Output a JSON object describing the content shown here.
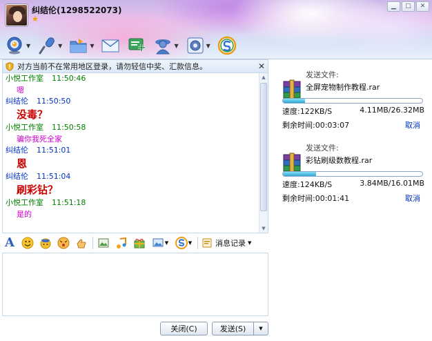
{
  "header": {
    "contact_name": "纠结伦(1298522073)",
    "window_buttons": [
      "minimize-icon",
      "maximize-icon",
      "close-icon"
    ],
    "toolbar": [
      {
        "name": "video-call",
        "icon": "webcam-icon",
        "has_dropdown": true
      },
      {
        "name": "voice-call",
        "icon": "microphone-icon",
        "has_dropdown": true
      },
      {
        "name": "send-file",
        "icon": "folder-icon",
        "has_dropdown": true
      },
      {
        "name": "send-mail",
        "icon": "envelope-icon",
        "has_dropdown": false
      },
      {
        "name": "create-discussion",
        "icon": "add-group-icon",
        "has_dropdown": false
      },
      {
        "name": "apps",
        "icon": "person-app-icon",
        "has_dropdown": true
      },
      {
        "name": "settings",
        "icon": "gear-icon",
        "has_dropdown": true
      },
      {
        "name": "soso",
        "icon": "soso-s-icon",
        "has_dropdown": false
      }
    ]
  },
  "notice": {
    "text": "对方当前不在常用地区登录，请勿轻信中奖、汇款信息。"
  },
  "chat": {
    "messages": [
      {
        "sender": "小悦工作室",
        "time": "11:50:46",
        "text": "嗯",
        "who": "other",
        "style": "normal"
      },
      {
        "sender": "纠结伦",
        "time": "11:50:50",
        "text": "没毒？",
        "who": "self",
        "style": "big"
      },
      {
        "sender": "小悦工作室",
        "time": "11:50:58",
        "text": "骗你我死全家",
        "who": "other",
        "style": "normal"
      },
      {
        "sender": "纠结伦",
        "time": "11:51:01",
        "text": "恩",
        "who": "self",
        "style": "big"
      },
      {
        "sender": "纠结伦",
        "time": "11:51:04",
        "text": "刷彩钻？",
        "who": "self",
        "style": "big"
      },
      {
        "sender": "小悦工作室",
        "time": "11:51:18",
        "text": "是的",
        "who": "other",
        "style": "normal"
      }
    ]
  },
  "format_toolbar": {
    "history_label": "消息记录"
  },
  "buttons": {
    "close_label": "关闭(C)",
    "send_label": "发送(S)"
  },
  "transfers": [
    {
      "label": "发送文件:",
      "file_name": "全屏宠物制作教程.rar",
      "progress": 0.156,
      "speed": "速度:122KB/S",
      "size": "4.11MB/26.32MB",
      "remaining": "剩余时间:00:03:07",
      "cancel_label": "取消"
    },
    {
      "label": "发送文件:",
      "file_name": "彩钻刷级数教程.rar",
      "progress": 0.24,
      "speed": "速度:124KB/S",
      "size": "3.84MB/16.01MB",
      "remaining": "剩余时间:00:01:41",
      "cancel_label": "取消"
    }
  ],
  "colors": {
    "self_name": "#0033cc",
    "other_name": "#008000",
    "big_text": "#cc0000",
    "normal_text": "#cc00cc",
    "cancel_link": "#0033cc"
  }
}
